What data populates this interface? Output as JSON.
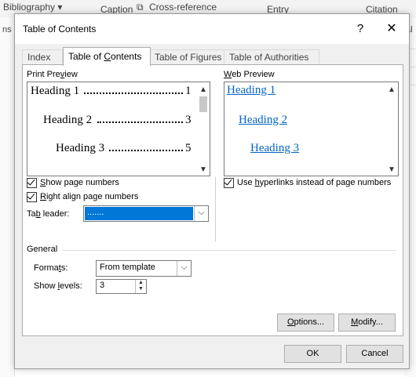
{
  "background": {
    "ribbon_items": [
      "Bibliography ▾",
      "Caption",
      "Cross-reference",
      "Entry",
      "Citation"
    ],
    "left_fragment": "ns",
    "right_fragment": "al"
  },
  "dialog": {
    "title": "Table of Contents",
    "help_glyph": "?",
    "close_glyph": "✕",
    "tabs": [
      {
        "label": "Index",
        "active": false
      },
      {
        "label": "Table of Contents",
        "active": true
      },
      {
        "label": "Table of Figures",
        "active": false
      },
      {
        "label": "Table of Authorities",
        "active": false
      }
    ],
    "print_preview": {
      "label": "Print Preview",
      "lines": [
        {
          "text": "Heading 1",
          "page": "1"
        },
        {
          "text": "Heading 2",
          "page": "3"
        },
        {
          "text": "Heading 3",
          "page": "5"
        }
      ]
    },
    "web_preview": {
      "label": "Web Preview",
      "links": [
        "Heading 1",
        "Heading 2",
        "Heading 3"
      ]
    },
    "options": {
      "show_page_numbers": {
        "label": "Show page numbers",
        "checked": true
      },
      "right_align": {
        "label": "Right align page numbers",
        "checked": true
      },
      "use_hyperlinks": {
        "label": "Use hyperlinks instead of page numbers",
        "checked": true
      },
      "tab_leader": {
        "label": "Tab leader:",
        "value": "......."
      }
    },
    "general": {
      "section_label": "General",
      "formats_label": "Formats:",
      "formats_value": "From template",
      "show_levels_label": "Show levels:",
      "show_levels_value": "3"
    },
    "buttons": {
      "options": "Options...",
      "modify": "Modify...",
      "ok": "OK",
      "cancel": "Cancel"
    }
  },
  "colors": {
    "accent": "#0078d7",
    "link": "#0563c1",
    "dialog_bg": "#f0f0f0"
  }
}
